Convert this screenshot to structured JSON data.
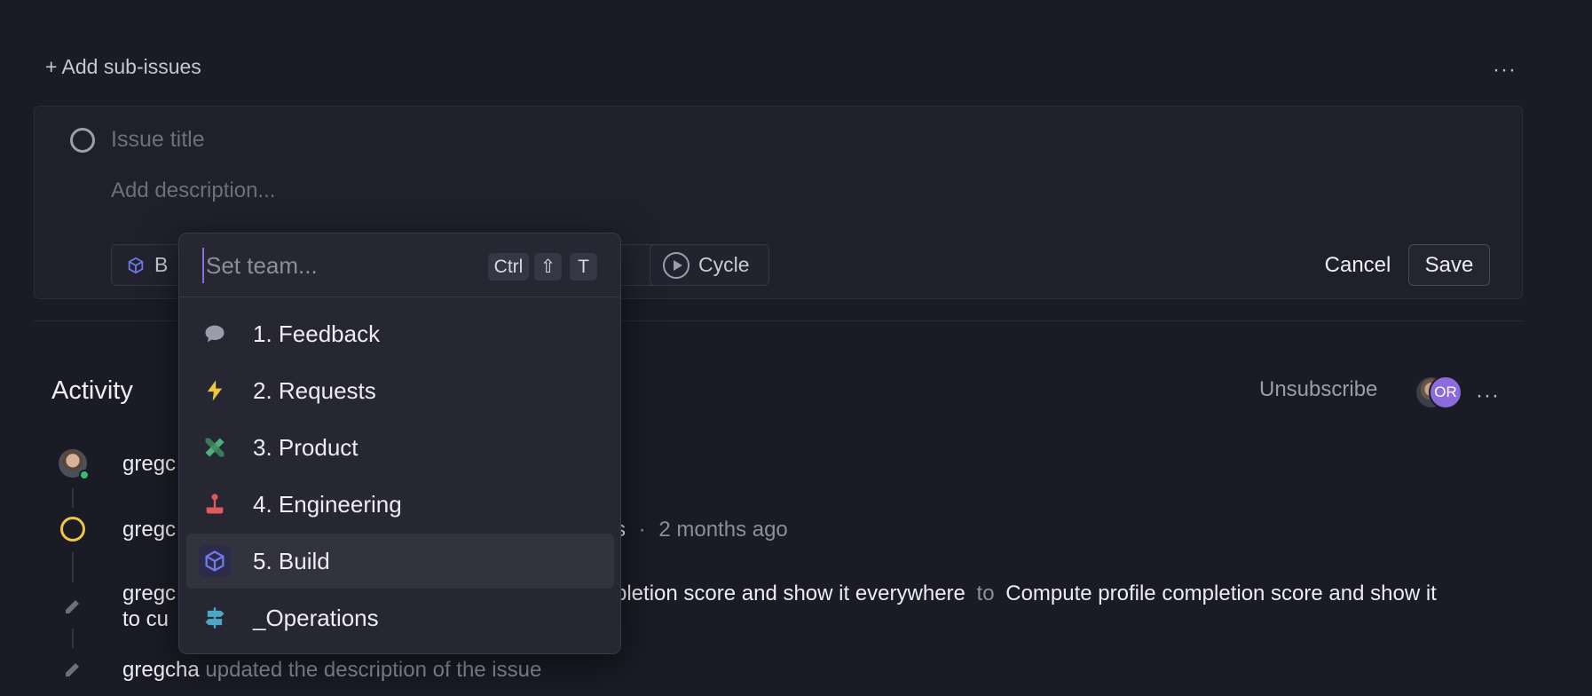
{
  "sub_issues": {
    "add_label": "+ Add sub-issues",
    "more": "···"
  },
  "editor": {
    "title_placeholder": "Issue title",
    "description_placeholder": "Add description...",
    "team_chip_label": "B",
    "cycle_label": "Cycle",
    "cancel_label": "Cancel",
    "save_label": "Save"
  },
  "team_dropdown": {
    "placeholder": "Set team...",
    "shortcut": [
      "Ctrl",
      "⇧",
      "T"
    ],
    "items": [
      {
        "label": "1. Feedback",
        "icon": "speech-bubble-icon",
        "color": "#9c9daa"
      },
      {
        "label": "2. Requests",
        "icon": "lightning-icon",
        "color": "#f0c541"
      },
      {
        "label": "3. Product",
        "icon": "ruler-pencil-icon",
        "color": "#4fae7a"
      },
      {
        "label": "4. Engineering",
        "icon": "joystick-icon",
        "color": "#e0595b"
      },
      {
        "label": "5. Build",
        "icon": "cube-icon",
        "color": "#6f78e8",
        "selected": true
      },
      {
        "label": "_Operations",
        "icon": "signpost-icon",
        "color": "#4fa6c4"
      }
    ]
  },
  "activity": {
    "title": "Activity",
    "unsubscribe_label": "Unsubscribe",
    "subscriber_initials": "OR",
    "more": "···",
    "entries": [
      {
        "user": "gregc"
      },
      {
        "user": "gregc",
        "text_tail": "s",
        "separator": "·",
        "time": "2 months ago"
      },
      {
        "user": "gregc",
        "old_title_tail": "pletion score and show it everywhere",
        "to": "to",
        "new_title": "Compute profile completion score and show it",
        "line2": "to cu"
      },
      {
        "user": "gregcha",
        "action": "updated the description of the issue"
      }
    ]
  },
  "colors": {
    "background": "#1b1b26",
    "panel": "#272733",
    "accent": "#8c6bdc",
    "status_yellow": "#f0c541"
  }
}
